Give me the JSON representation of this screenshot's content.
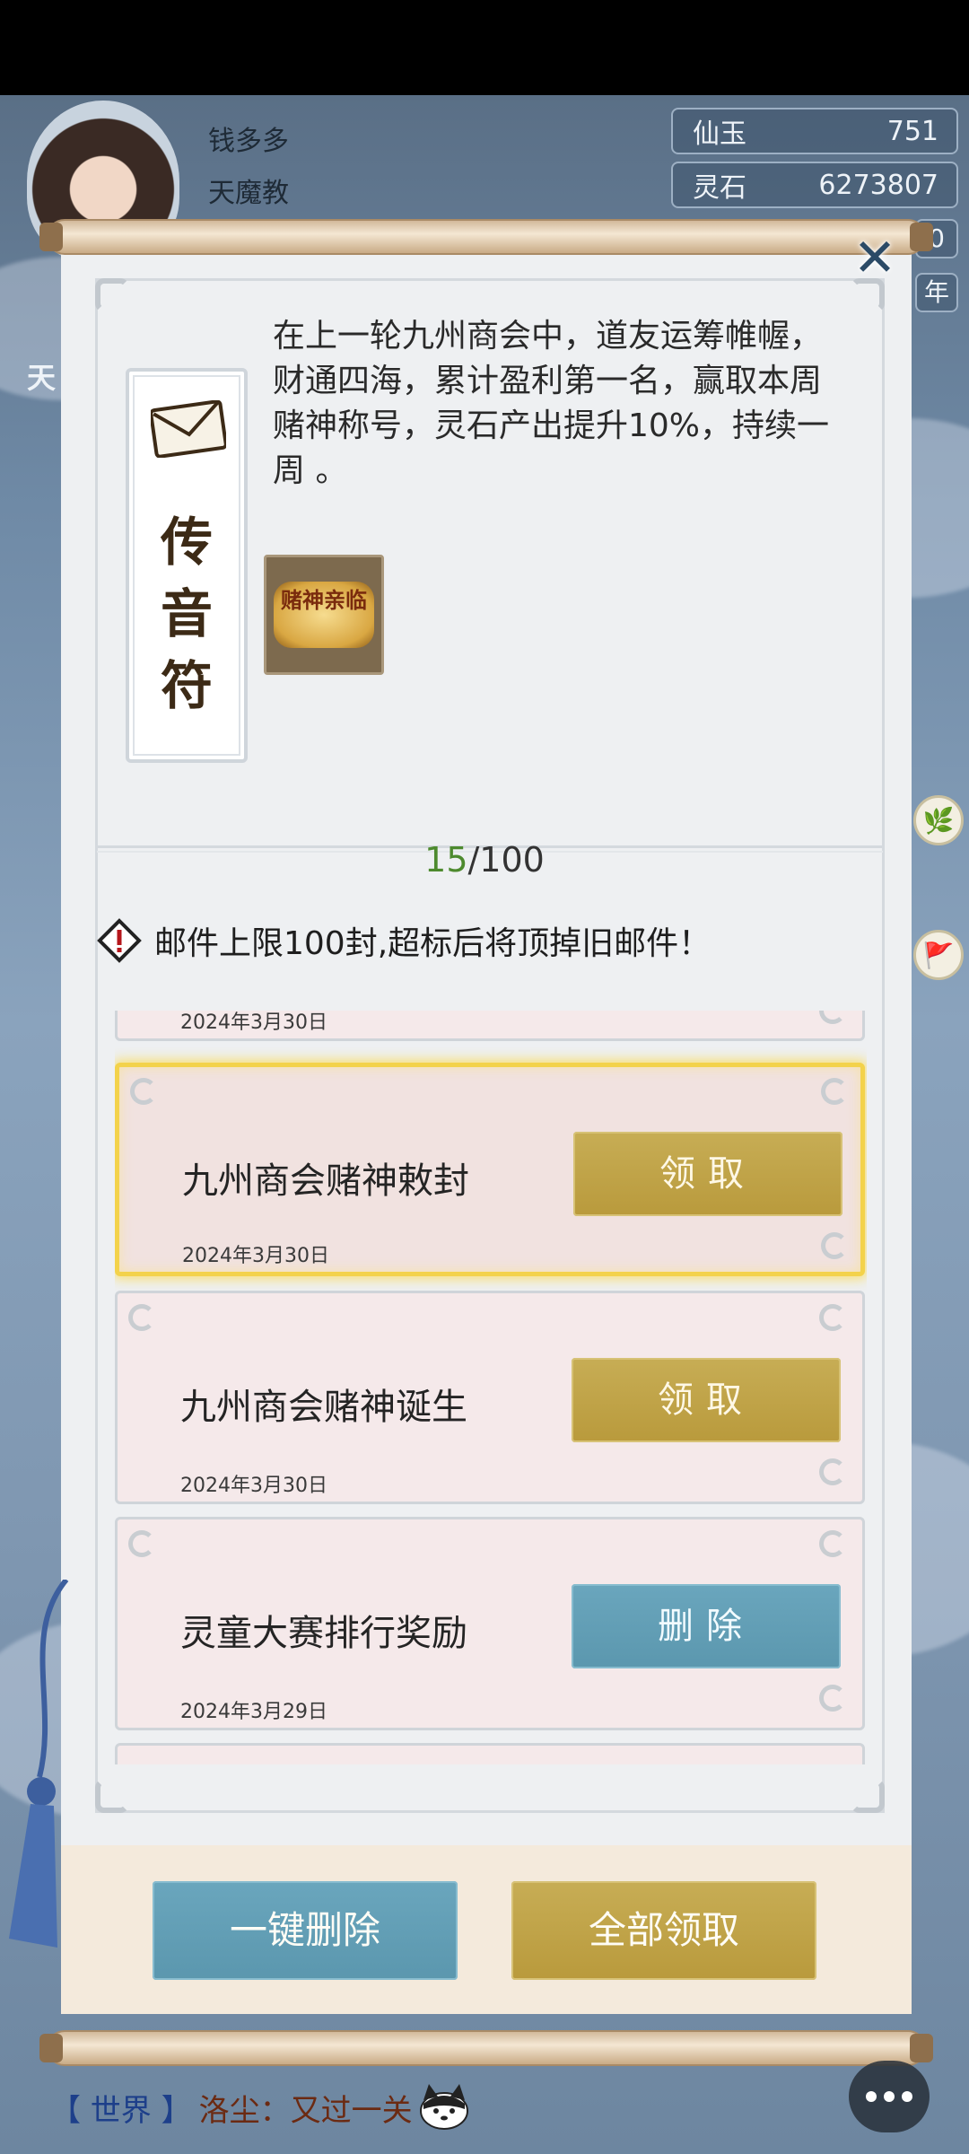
{
  "player": {
    "name": "钱多多",
    "sect": "天魔教"
  },
  "resources": [
    {
      "label": "仙玉",
      "value": "751"
    },
    {
      "label": "灵石",
      "value": "6273807"
    }
  ],
  "side_tags": {
    "top_partial": "0",
    "second_partial": "年",
    "left_partial": "天"
  },
  "mail_detail": {
    "card_title": "传音符",
    "body": "在上一轮九州商会中，道友运筹帷幄，财通四海，累计盈利第一名，赢取本周赌神称号，灵石产出提升10%，持续一周 。",
    "reward_item_label": "赌神亲临"
  },
  "mail_count": {
    "current": "15",
    "max": "/100"
  },
  "notice": "邮件上限100封,超标后将顶掉旧邮件！",
  "mails": [
    {
      "title": "",
      "date": "2024年3月30日",
      "button": ""
    },
    {
      "title": "九州商会赌神敕封",
      "date": "2024年3月30日",
      "button": "领取",
      "selected": true
    },
    {
      "title": "九州商会赌神诞生",
      "date": "2024年3月30日",
      "button": "领取"
    },
    {
      "title": "灵童大赛排行奖励",
      "date": "2024年3月29日",
      "button": "删除"
    }
  ],
  "footer": {
    "delete_all": "一键删除",
    "claim_all": "全部领取"
  },
  "chat": {
    "channel": "【 世界 】",
    "speaker": "洛尘：",
    "message": "又过一关"
  },
  "colors": {
    "gold_button": "#bda046",
    "blue_button": "#62a0b7",
    "selected_glow": "#f3d24b",
    "count_current": "#4d8a2e"
  }
}
